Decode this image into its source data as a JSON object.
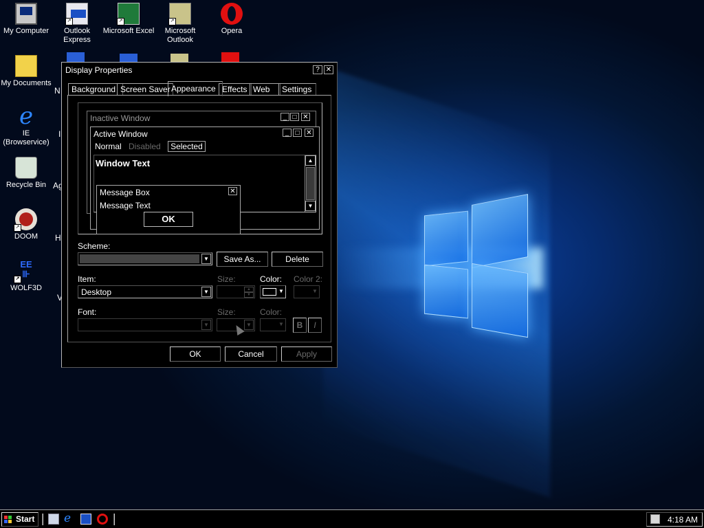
{
  "desktop": {
    "icons": [
      {
        "label": "My Computer",
        "icon": "my-computer-icon"
      },
      {
        "label": "Outlook Express",
        "icon": "outlook-express-icon"
      },
      {
        "label": "Microsoft Excel",
        "icon": "excel-icon"
      },
      {
        "label": "Microsoft Outlook",
        "icon": "outlook-icon"
      },
      {
        "label": "Opera",
        "icon": "opera-icon"
      },
      {
        "label": "My Documents",
        "icon": "my-documents-icon"
      },
      {
        "label": "IE (Browservice)",
        "icon": "internet-explorer-icon"
      },
      {
        "label": "Recycle Bin",
        "icon": "recycle-bin-icon"
      },
      {
        "label": "DOOM",
        "icon": "doom-icon"
      },
      {
        "label": "WOLF3D",
        "icon": "wolf3d-icon"
      }
    ],
    "partial_labels": [
      "N",
      "I",
      "Ag",
      "H",
      "V"
    ]
  },
  "dialog": {
    "title": "Display Properties",
    "help_button": "?",
    "close_button": "✕",
    "tabs": [
      "Background",
      "Screen Saver",
      "Appearance",
      "Effects",
      "Web",
      "Settings"
    ],
    "active_tab": "Appearance",
    "preview": {
      "inactive_title": "Inactive Window",
      "active_title": "Active Window",
      "menu": {
        "normal": "Normal",
        "disabled": "Disabled",
        "selected": "Selected"
      },
      "window_text": "Window Text",
      "message_box_title": "Message Box",
      "message_text": "Message Text",
      "ok": "OK"
    },
    "scheme": {
      "label": "Scheme:",
      "value": "",
      "save_as": "Save As...",
      "delete": "Delete"
    },
    "item": {
      "label": "Item:",
      "value": "Desktop",
      "size_label": "Size:",
      "color_label": "Color:",
      "color2_label": "Color 2:",
      "color_value": "#000000"
    },
    "font": {
      "label": "Font:",
      "value": "",
      "size_label": "Size:",
      "color_label": "Color:",
      "bold": "B",
      "italic": "I"
    },
    "buttons": {
      "ok": "OK",
      "cancel": "Cancel",
      "apply": "Apply"
    }
  },
  "taskbar": {
    "start_label": "Start",
    "quick_launch": [
      "show-desktop-icon",
      "internet-explorer-icon",
      "outlook-express-icon",
      "opera-icon"
    ],
    "clock": "4:18 AM"
  },
  "colors": {
    "accent_blue": "#1a6bff",
    "window_bg": "#000000",
    "text": "#ffffff",
    "disabled_text": "#6a6a6a"
  }
}
